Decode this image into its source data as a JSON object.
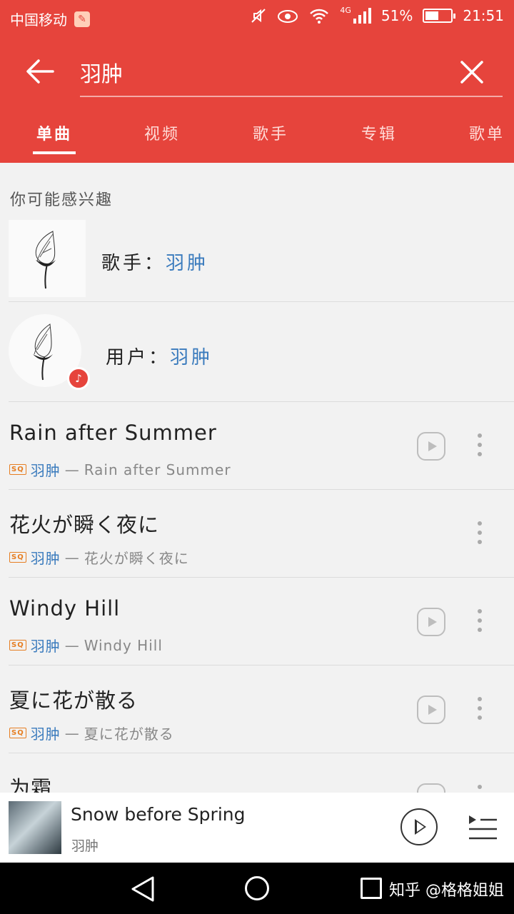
{
  "status_bar": {
    "carrier": "中国移动",
    "network": "4G",
    "battery": "51%",
    "time": "21:51"
  },
  "search": {
    "query": "羽肿"
  },
  "tabs": [
    {
      "label": "单曲",
      "active": true
    },
    {
      "label": "视频"
    },
    {
      "label": "歌手"
    },
    {
      "label": "专辑"
    },
    {
      "label": "歌单"
    }
  ],
  "suggest": {
    "title": "你可能感兴趣",
    "singer": {
      "prefix": "歌手：",
      "name": "羽肿"
    },
    "user": {
      "prefix": "用户：",
      "name": "羽肿"
    }
  },
  "songs": [
    {
      "title": "Rain after Summer",
      "quality": "SQ",
      "artist": "羽肿",
      "separator": "—",
      "album": "Rain after Summer",
      "has_play": true
    },
    {
      "title": "花火が瞬く夜に",
      "quality": "SQ",
      "artist": "羽肿",
      "separator": "—",
      "album": "花火が瞬く夜に",
      "has_play": false
    },
    {
      "title": "Windy Hill",
      "quality": "SQ",
      "artist": "羽肿",
      "separator": "—",
      "album": "Windy Hill",
      "has_play": true
    },
    {
      "title": "夏に花が散る",
      "quality": "SQ",
      "artist": "羽肿",
      "separator": "—",
      "album": "夏に花が散る",
      "has_play": true
    },
    {
      "title": "为霜",
      "has_play": true
    }
  ],
  "now_playing": {
    "title": "Snow before Spring",
    "artist": "羽肿"
  },
  "watermark": "知乎 @格格姐姐",
  "colors": {
    "accent": "#e6443c",
    "link": "#3a7bbd"
  }
}
